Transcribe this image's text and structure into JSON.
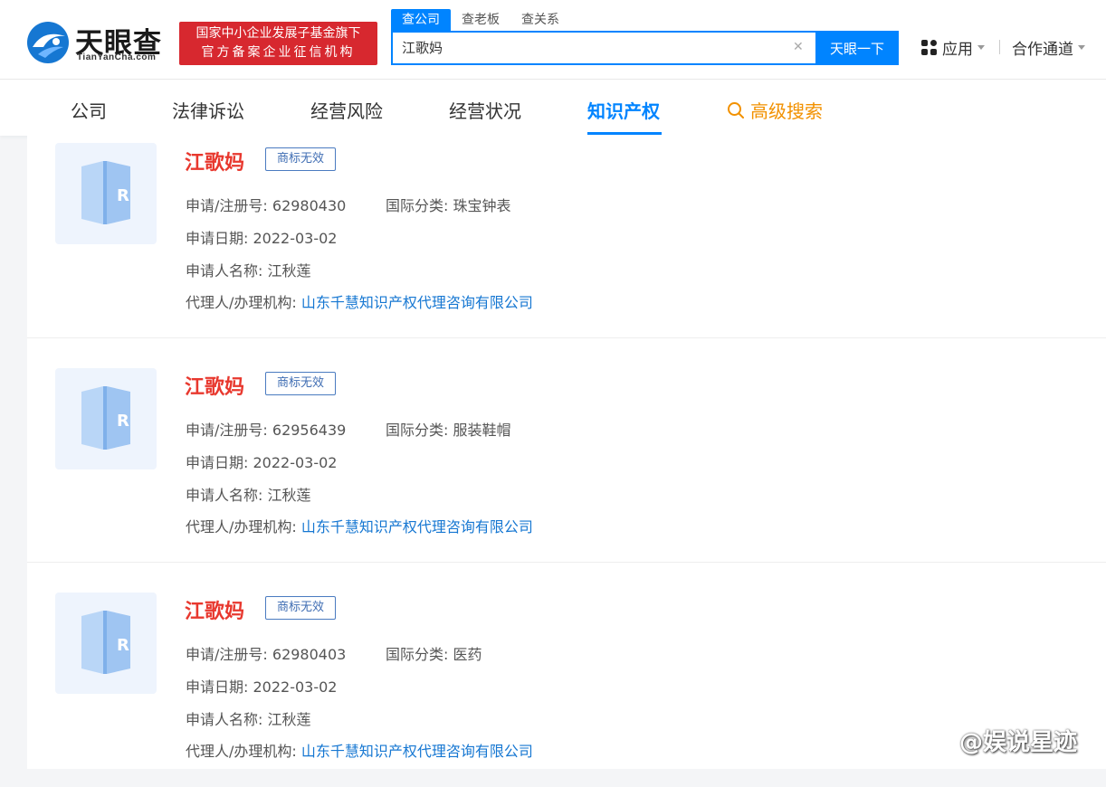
{
  "header": {
    "logo_cn": "天眼查",
    "logo_en": "TianYanCha.com",
    "badge_line1": "国家中小企业发展子基金旗下",
    "badge_line2": "官方备案企业征信机构",
    "search_tabs": [
      "查公司",
      "查老板",
      "查关系"
    ],
    "search_value": "江歌妈",
    "search_button": "天眼一下",
    "apps_label": "应用",
    "coop_label": "合作通道"
  },
  "nav": {
    "items": [
      "公司",
      "法律诉讼",
      "经营风险",
      "经营状况",
      "知识产权"
    ],
    "advanced": "高级搜索"
  },
  "labels": {
    "reg_no": "申请/注册号:",
    "intl_class": "国际分类:",
    "apply_date": "申请日期:",
    "applicant": "申请人名称:",
    "agent": "代理人/办理机构:"
  },
  "trademarks": [
    {
      "name": "江歌妈",
      "status": "商标无效",
      "reg_no": "62980430",
      "intl_class": "珠宝钟表",
      "apply_date": "2022-03-02",
      "applicant": "江秋莲",
      "agent": "山东千慧知识产权代理咨询有限公司"
    },
    {
      "name": "江歌妈",
      "status": "商标无效",
      "reg_no": "62956439",
      "intl_class": "服装鞋帽",
      "apply_date": "2022-03-02",
      "applicant": "江秋莲",
      "agent": "山东千慧知识产权代理咨询有限公司"
    },
    {
      "name": "江歌妈",
      "status": "商标无效",
      "reg_no": "62980403",
      "intl_class": "医药",
      "apply_date": "2022-03-02",
      "applicant": "江秋莲",
      "agent": "山东千慧知识产权代理咨询有限公司"
    }
  ],
  "watermark": "@娱说星迹"
}
